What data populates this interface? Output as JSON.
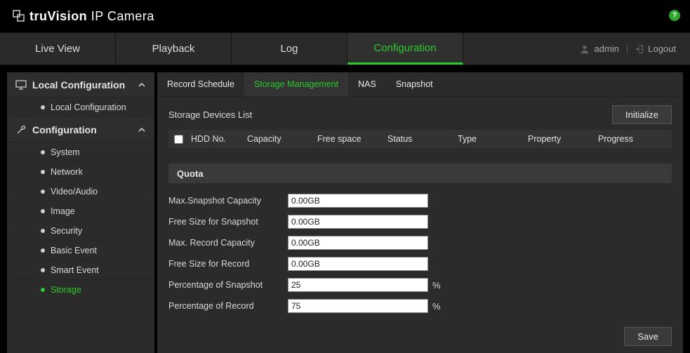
{
  "brand": {
    "logo_bold": "truVision",
    "logo_rest": " IP Camera"
  },
  "help_icon_label": "?",
  "nav": {
    "tabs": [
      "Live View",
      "Playback",
      "Log",
      "Configuration"
    ],
    "active_index": 3
  },
  "user": {
    "name": "admin",
    "logout_label": "Logout"
  },
  "sidebar": {
    "sections": [
      {
        "title": "Local Configuration",
        "items": [
          "Local Configuration"
        ],
        "active_index": -1
      },
      {
        "title": "Configuration",
        "items": [
          "System",
          "Network",
          "Video/Audio",
          "Image",
          "Security",
          "Basic Event",
          "Smart Event",
          "Storage"
        ],
        "active_index": 7
      }
    ]
  },
  "subtabs": {
    "items": [
      "Record Schedule",
      "Storage Management",
      "NAS",
      "Snapshot"
    ],
    "active_index": 1
  },
  "storage_list": {
    "title": "Storage Devices List",
    "initialize_label": "Initialize",
    "columns": [
      "HDD No.",
      "Capacity",
      "Free space",
      "Status",
      "Type",
      "Property",
      "Progress"
    ],
    "rows": []
  },
  "quota": {
    "section_title": "Quota",
    "fields": [
      {
        "label": "Max.Snapshot Capacity",
        "value": "0.00GB",
        "readonly": true,
        "suffix": ""
      },
      {
        "label": "Free Size for Snapshot",
        "value": "0.00GB",
        "readonly": true,
        "suffix": ""
      },
      {
        "label": "Max. Record Capacity",
        "value": "0.00GB",
        "readonly": true,
        "suffix": ""
      },
      {
        "label": "Free Size for Record",
        "value": "0.00GB",
        "readonly": true,
        "suffix": ""
      },
      {
        "label": "Percentage of Snapshot",
        "value": "25",
        "readonly": false,
        "suffix": "%"
      },
      {
        "label": "Percentage of Record",
        "value": "75",
        "readonly": false,
        "suffix": "%"
      }
    ]
  },
  "save_label": "Save"
}
